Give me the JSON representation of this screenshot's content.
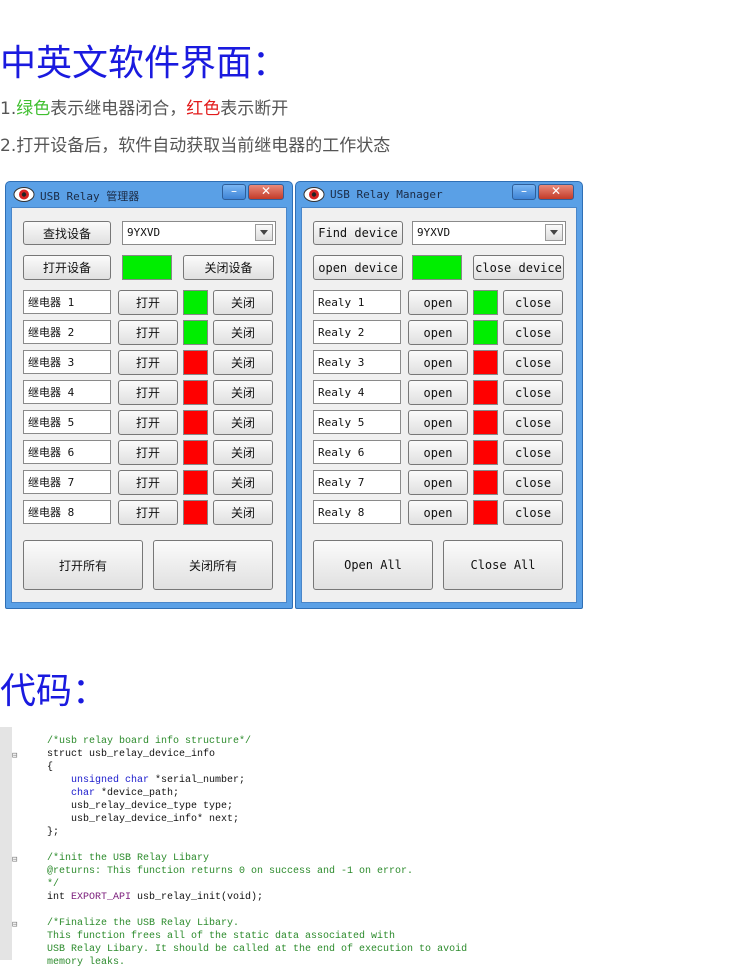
{
  "heading1": "中英文软件界面：",
  "note1": {
    "prefix": "1.",
    "green_word": "绿色",
    "mid": "表示继电器闭合，",
    "red_word": "红色",
    "suffix": "表示断开"
  },
  "note2": "2.打开设备后，软件自动获取当前继电器的工作状态",
  "colors": {
    "heading": "#1a1adf",
    "closed": "#00ee00",
    "open": "#ff0000",
    "window_frame": "#5aa0e6"
  },
  "window_cn": {
    "title": "USB Relay 管理器",
    "find_label": "查找设备",
    "device_value": "9YXVD",
    "open_device_label": "打开设备",
    "close_device_label": "关闭设备",
    "device_status": "closed",
    "relays": [
      {
        "name": "继电器 1",
        "open": "打开",
        "close": "关闭",
        "state": "closed"
      },
      {
        "name": "继电器 2",
        "open": "打开",
        "close": "关闭",
        "state": "closed"
      },
      {
        "name": "继电器 3",
        "open": "打开",
        "close": "关闭",
        "state": "open"
      },
      {
        "name": "继电器 4",
        "open": "打开",
        "close": "关闭",
        "state": "open"
      },
      {
        "name": "继电器 5",
        "open": "打开",
        "close": "关闭",
        "state": "open"
      },
      {
        "name": "继电器 6",
        "open": "打开",
        "close": "关闭",
        "state": "open"
      },
      {
        "name": "继电器 7",
        "open": "打开",
        "close": "关闭",
        "state": "open"
      },
      {
        "name": "继电器 8",
        "open": "打开",
        "close": "关闭",
        "state": "open"
      }
    ],
    "open_all": "打开所有",
    "close_all": "关闭所有"
  },
  "window_en": {
    "title": "USB Relay Manager",
    "find_label": "Find device",
    "device_value": "9YXVD",
    "open_device_label": "open device",
    "close_device_label": "close device",
    "device_status": "closed",
    "relays": [
      {
        "name": "Realy 1",
        "open": "open",
        "close": "close",
        "state": "closed"
      },
      {
        "name": "Realy 2",
        "open": "open",
        "close": "close",
        "state": "closed"
      },
      {
        "name": "Realy 3",
        "open": "open",
        "close": "close",
        "state": "open"
      },
      {
        "name": "Realy 4",
        "open": "open",
        "close": "close",
        "state": "open"
      },
      {
        "name": "Realy 5",
        "open": "open",
        "close": "close",
        "state": "open"
      },
      {
        "name": "Realy 6",
        "open": "open",
        "close": "close",
        "state": "open"
      },
      {
        "name": "Realy 7",
        "open": "open",
        "close": "close",
        "state": "open"
      },
      {
        "name": "Realy 8",
        "open": "open",
        "close": "close",
        "state": "open"
      }
    ],
    "open_all": "Open All",
    "close_all": "Close All"
  },
  "heading2": "代码：",
  "code_lines": [
    {
      "kind": "com",
      "text": "/*usb relay board info structure*/"
    },
    {
      "kind": "txt",
      "text": "struct usb_relay_device_info"
    },
    {
      "kind": "txt",
      "text": "{"
    },
    {
      "kind": "mix",
      "kw": "    unsigned char ",
      "rest": "*serial_number;"
    },
    {
      "kind": "mix",
      "kw": "    char ",
      "rest": "*device_path;"
    },
    {
      "kind": "txt",
      "text": "    usb_relay_device_type type;"
    },
    {
      "kind": "txt",
      "text": "    usb_relay_device_info* next;"
    },
    {
      "kind": "txt",
      "text": "};"
    },
    {
      "kind": "blank",
      "text": ""
    },
    {
      "kind": "com",
      "text": "/*init the USB Relay Libary"
    },
    {
      "kind": "com",
      "text": "@returns: This function returns 0 on success and -1 on error."
    },
    {
      "kind": "com",
      "text": "*/"
    },
    {
      "kind": "api",
      "kw": "int ",
      "macro": "EXPORT_API",
      "rest": " usb_relay_init(void);"
    },
    {
      "kind": "blank",
      "text": ""
    },
    {
      "kind": "com",
      "text": "/*Finalize the USB Relay Libary."
    },
    {
      "kind": "com",
      "text": "This function frees all of the static data associated with"
    },
    {
      "kind": "com",
      "text": "USB Relay Libary. It should be called at the end of execution to avoid"
    },
    {
      "kind": "com",
      "text": "memory leaks."
    }
  ]
}
